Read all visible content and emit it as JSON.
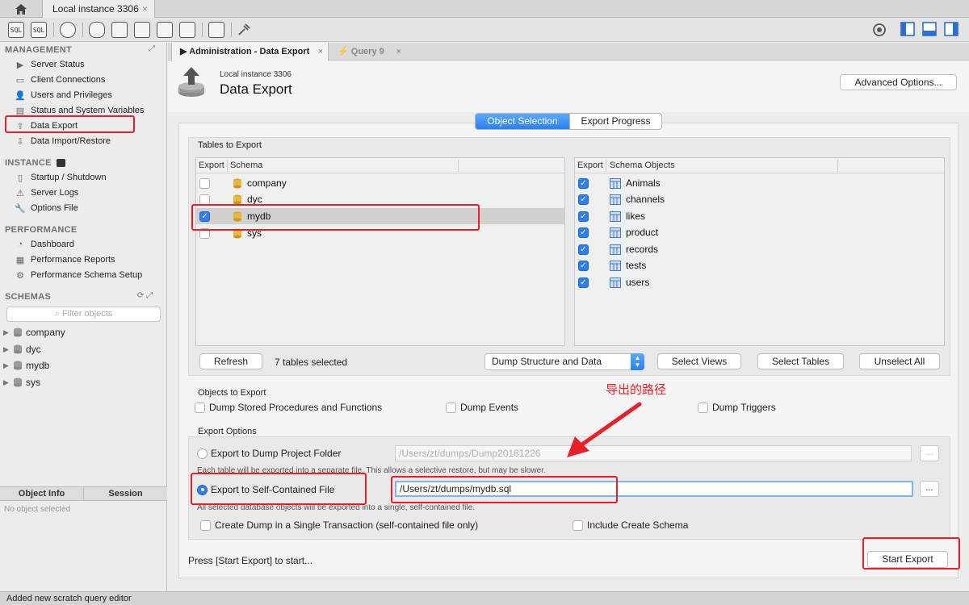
{
  "window": {
    "home_icon": "home-icon",
    "instance_tab": "Local instance 3306",
    "close_glyph": "×"
  },
  "toolbar": {
    "icons": [
      "new-sql-tab-icon",
      "open-sql-script-icon",
      "inspector-icon",
      "create-schema-icon",
      "create-table-icon",
      "create-view-icon",
      "create-procedure-icon",
      "create-function-icon",
      "search-table-data-icon",
      "reconnect-icon"
    ],
    "icon_labels": [
      "SQL",
      "SQL",
      "",
      "",
      "",
      "",
      "",
      "",
      "",
      ""
    ],
    "right_icons": [
      "preferences-icon",
      "toggle-sidebar-icon",
      "toggle-output-icon",
      "toggle-secondary-sidebar-icon"
    ]
  },
  "sidebar": {
    "management_header": "MANAGEMENT",
    "management_items": [
      "Server Status",
      "Client Connections",
      "Users and Privileges",
      "Status and System Variables",
      "Data Export",
      "Data Import/Restore"
    ],
    "instance_header": "INSTANCE",
    "instance_items": [
      "Startup / Shutdown",
      "Server Logs",
      "Options File"
    ],
    "performance_header": "PERFORMANCE",
    "performance_items": [
      "Dashboard",
      "Performance Reports",
      "Performance Schema Setup"
    ],
    "schemas_header": "SCHEMAS",
    "filter_placeholder": "Filter objects",
    "schemas": [
      "company",
      "dyc",
      "mydb",
      "sys"
    ],
    "info_tabs": [
      "Object Info",
      "Session"
    ],
    "no_object": "No object selected"
  },
  "doc_tabs": [
    {
      "label": "Administration - Data Export",
      "active": true
    },
    {
      "label": "Query 9",
      "active": false
    }
  ],
  "header": {
    "subtitle": "Local instance 3306",
    "title": "Data Export",
    "advanced_button": "Advanced Options..."
  },
  "segments": [
    "Object Selection",
    "Export Progress"
  ],
  "tables_to_export": {
    "label": "Tables to Export",
    "schema_panel": {
      "columns": [
        "Export",
        "Schema"
      ],
      "rows": [
        {
          "name": "company",
          "checked": false
        },
        {
          "name": "dyc",
          "checked": false
        },
        {
          "name": "mydb",
          "checked": true
        },
        {
          "name": "sys",
          "checked": false
        }
      ]
    },
    "objects_panel": {
      "columns": [
        "Export",
        "Schema Objects"
      ],
      "rows": [
        {
          "name": "Animals",
          "checked": true
        },
        {
          "name": "channels",
          "checked": true
        },
        {
          "name": "likes",
          "checked": true
        },
        {
          "name": "product",
          "checked": true
        },
        {
          "name": "records",
          "checked": true
        },
        {
          "name": "tests",
          "checked": true
        },
        {
          "name": "users",
          "checked": true
        }
      ]
    },
    "refresh_button": "Refresh",
    "selected_count": "7 tables selected",
    "dump_mode": "Dump Structure and Data",
    "select_views": "Select Views",
    "select_tables": "Select Tables",
    "unselect_all": "Unselect All"
  },
  "objects_to_export": {
    "label": "Objects to Export",
    "items": [
      "Dump Stored Procedures and Functions",
      "Dump Events",
      "Dump Triggers"
    ]
  },
  "export_options": {
    "label": "Export Options",
    "folder_option": "Export to Dump Project Folder",
    "folder_path": "/Users/zt/dumps/Dump20181226",
    "folder_note": "Each table will be exported into a separate file. This allows a selective restore, but may be slower.",
    "file_option": "Export to Self-Contained File",
    "file_path": "/Users/zt/dumps/mydb.sql",
    "file_note": "All selected database objects will be exported into a single, self-contained file.",
    "single_transaction": "Create Dump in a Single Transaction (self-contained file only)",
    "include_schema": "Include Create Schema",
    "browse": "..."
  },
  "footer": {
    "hint": "Press [Start Export] to start...",
    "start_button": "Start Export"
  },
  "annotation": {
    "text": "导出的路径",
    "color": "#e8202a"
  },
  "status": "Added new scratch query editor",
  "colors": {
    "accent": "#2d7ff0",
    "annotation": "#e8202a"
  }
}
